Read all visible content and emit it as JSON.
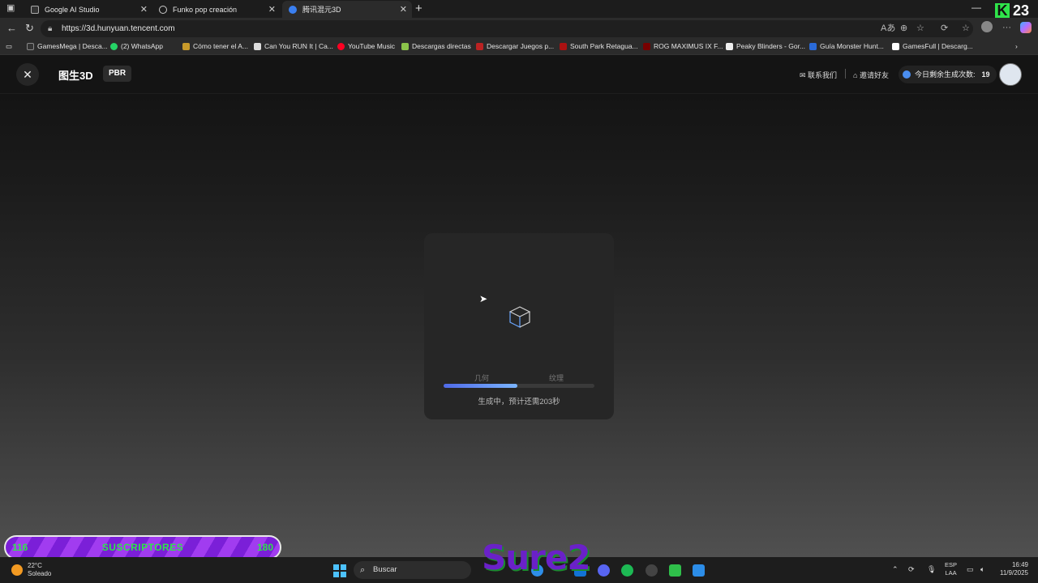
{
  "browser": {
    "tabs": [
      {
        "title": "Google AI Studio"
      },
      {
        "title": "Funko pop creación"
      },
      {
        "title": "腾讯混元3D"
      }
    ],
    "url": "https://3d.hunyuan.tencent.com",
    "bookmarks": [
      "GamesMega | Desca...",
      "(2) WhatsApp",
      "Cómo tener el A...",
      "Can You RUN It | Ca...",
      "YouTube Music",
      "Descargas directas",
      "Descargar Juegos p...",
      "South Park Retagua...",
      "ROG MAXIMUS IX F...",
      "Peaky Blinders - Gor...",
      "Guía Monster Hunt...",
      "GamesFull | Descarg..."
    ]
  },
  "app": {
    "title": "图生3D",
    "badge": "PBR",
    "contact": "联系我们",
    "invite": "邀请好友",
    "quota_label": "今日剩余生成次数:",
    "quota_value": "19"
  },
  "progress": {
    "step1": "几何",
    "step2": "纹理",
    "fraction": 0.49,
    "status": "生成中，预计还需203秒"
  },
  "overlay": {
    "subs_left": "116",
    "subs_label": "SUSCRIPTORES",
    "subs_right": "180",
    "watermark": "Sure2",
    "corner_badge": "23"
  },
  "taskbar": {
    "weather_temp": "22°C",
    "weather_desc": "Soleado",
    "search": "Buscar",
    "lang1": "ESP",
    "lang2": "LAA",
    "time": "16:49",
    "date": "11/9/2025"
  }
}
